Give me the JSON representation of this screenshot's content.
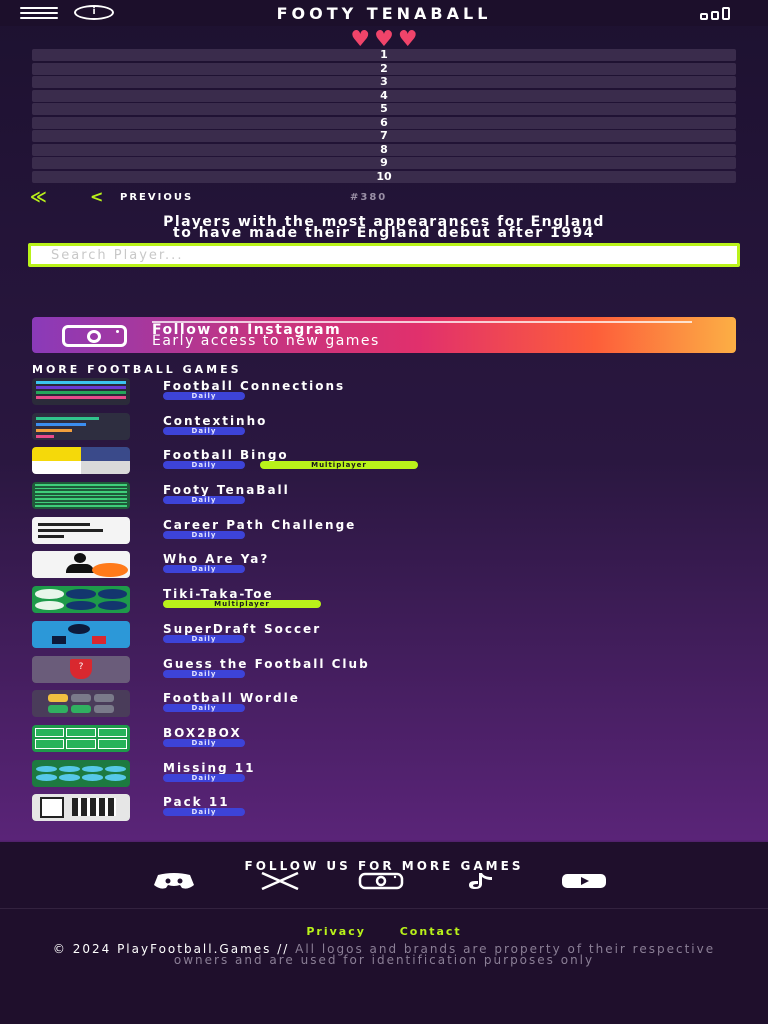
{
  "header": {
    "title": "FOOTY TENABALL",
    "info_label": "i",
    "menu_icon": "hamburger-menu-icon",
    "stats_icon": "bar-chart-icon"
  },
  "lives": {
    "hearts": 3,
    "color": "#f0446a"
  },
  "answers": [
    "1",
    "2",
    "3",
    "4",
    "5",
    "6",
    "7",
    "8",
    "9",
    "10"
  ],
  "nav": {
    "first_label": "≪",
    "prev_arrow": "<",
    "prev_label": "PREVIOUS",
    "puzzle_number": "#380"
  },
  "question": {
    "line1": "Players with the most appearances for England",
    "line2": "to have made their England debut after 1994"
  },
  "search": {
    "placeholder": "Search Player..."
  },
  "instagram": {
    "title": "Follow on Instagram",
    "subtitle": "Early access to new games"
  },
  "more_games": {
    "title": "MORE FOOTBALL GAMES",
    "games": [
      {
        "name": "Football Connections",
        "badges": [
          "Daily"
        ],
        "icon": "connections"
      },
      {
        "name": "Contextinho",
        "badges": [
          "Daily"
        ],
        "icon": "contextinho"
      },
      {
        "name": "Football Bingo",
        "badges": [
          "Daily",
          "Multiplayer"
        ],
        "icon": "bingo"
      },
      {
        "name": "Footy TenaBall",
        "badges": [
          "Daily"
        ],
        "icon": "tenaball"
      },
      {
        "name": "Career Path Challenge",
        "badges": [
          "Daily"
        ],
        "icon": "career"
      },
      {
        "name": "Who Are Ya?",
        "badges": [
          "Daily"
        ],
        "icon": "whoareya"
      },
      {
        "name": "Tiki-Taka-Toe",
        "badges": [
          "Multiplayer"
        ],
        "icon": "tikitaka"
      },
      {
        "name": "SuperDraft Soccer",
        "badges": [
          "Daily"
        ],
        "icon": "superdraft"
      },
      {
        "name": "Guess the Football Club",
        "badges": [
          "Daily"
        ],
        "icon": "guessclub"
      },
      {
        "name": "Football Wordle",
        "badges": [
          "Daily"
        ],
        "icon": "wordle"
      },
      {
        "name": "BOX2BOX",
        "badges": [
          "Daily"
        ],
        "icon": "box2box"
      },
      {
        "name": "Missing 11",
        "badges": [
          "Daily"
        ],
        "icon": "missing11"
      },
      {
        "name": "Pack 11",
        "badges": [
          "Daily"
        ],
        "icon": "pack11"
      }
    ]
  },
  "footer": {
    "follow_title": "FOLLOW US FOR MORE GAMES",
    "socials": [
      "discord-icon",
      "x-icon",
      "instagram-icon",
      "tiktok-icon",
      "youtube-icon"
    ],
    "privacy": "Privacy",
    "contact": "Contact",
    "copyright_brand": "© 2024 PlayFootball.Games //",
    "copyright_text": "All logos and brands are property of their respective owners and are used for identification purposes only"
  },
  "colors": {
    "accent": "#b9f21a",
    "daily_badge": "#3d43d8",
    "heart": "#f0446a"
  }
}
